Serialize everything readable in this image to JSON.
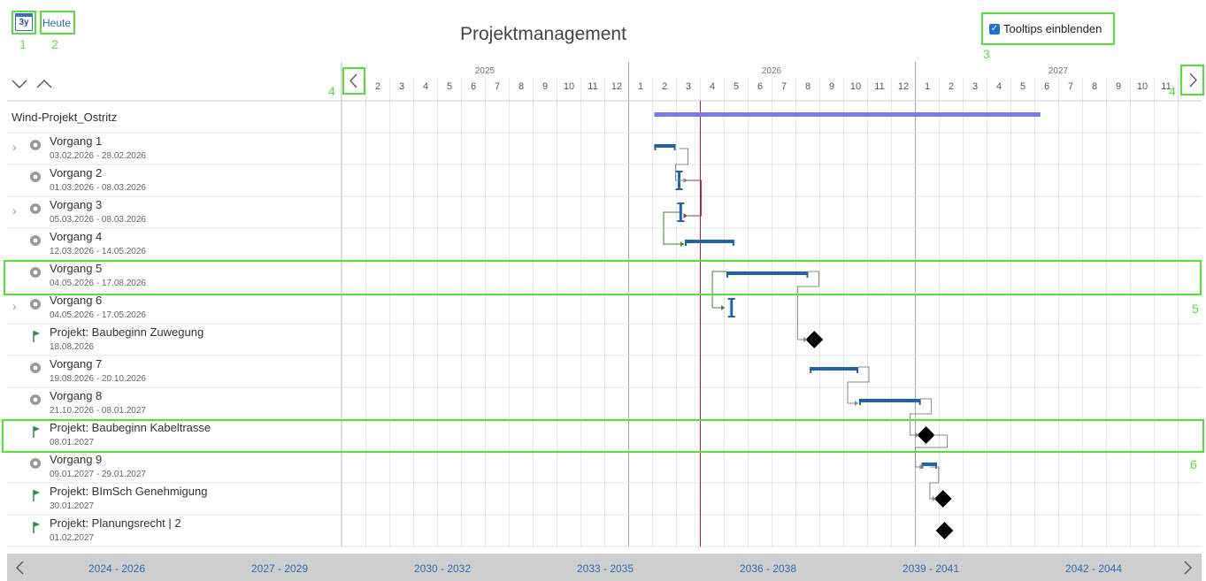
{
  "toolbar": {
    "zoom_label": "3y",
    "today_label": "Heute"
  },
  "title": "Projektmanagement",
  "tooltips": {
    "label": "Tooltips einblenden",
    "checked": true
  },
  "annotations": [
    "1",
    "2",
    "3",
    "4",
    "4",
    "5",
    "6"
  ],
  "timeline": {
    "years": [
      "2025",
      "2026",
      "2027"
    ],
    "months_2025": [
      "2",
      "3",
      "4",
      "5",
      "6",
      "7",
      "8",
      "9",
      "10",
      "11",
      "12"
    ],
    "months_2026": [
      "1",
      "2",
      "3",
      "4",
      "5",
      "6",
      "7",
      "8",
      "9",
      "10",
      "11",
      "12"
    ],
    "months_2027": [
      "1",
      "2",
      "3",
      "4",
      "5",
      "6",
      "7",
      "8",
      "9",
      "10",
      "11"
    ]
  },
  "project": {
    "name": "Wind-Projekt_Ostritz"
  },
  "tasks": [
    {
      "name": "Vorgang 1",
      "dates": "03.02.2026 - 28.02.2026",
      "icon": "gear-icon",
      "expandable": true
    },
    {
      "name": "Vorgang 2",
      "dates": "01.03.2026 - 08.03.2026",
      "icon": "gear-icon",
      "expandable": false
    },
    {
      "name": "Vorgang 3",
      "dates": "05.03.2026 - 08.03.2026",
      "icon": "gear-icon",
      "expandable": true
    },
    {
      "name": "Vorgang 4",
      "dates": "12.03.2026 - 14.05.2026",
      "icon": "gear-icon",
      "expandable": false
    },
    {
      "name": "Vorgang 5",
      "dates": "04.05.2026 - 17.08.2026",
      "icon": "gear-icon",
      "expandable": false
    },
    {
      "name": "Vorgang 6",
      "dates": "04.05.2026 - 17.05.2026",
      "icon": "gear-icon",
      "expandable": true
    },
    {
      "name": "Projekt: Baubeginn Zuwegung",
      "dates": "18.08.2026",
      "icon": "flag-icon",
      "expandable": false
    },
    {
      "name": "Vorgang 7",
      "dates": "19.08.2026 - 20.10.2026",
      "icon": "gear-icon",
      "expandable": false
    },
    {
      "name": "Vorgang 8",
      "dates": "21.10.2026 - 08.01.2027",
      "icon": "gear-icon",
      "expandable": false
    },
    {
      "name": "Projekt: Baubeginn Kabeltrasse",
      "dates": "08.01.2027",
      "icon": "flag-icon",
      "expandable": false
    },
    {
      "name": "Vorgang 9",
      "dates": "09.01.2027 - 29.01.2027",
      "icon": "gear-icon",
      "expandable": false
    },
    {
      "name": "Projekt: BImSch Genehmigung",
      "dates": "30.01.2027",
      "icon": "flag-icon",
      "expandable": false
    },
    {
      "name": "Projekt: Planungsrecht | 2",
      "dates": "01.02.2027",
      "icon": "flag-icon",
      "expandable": false
    }
  ],
  "periods": [
    "2024 - 2026",
    "2027 - 2029",
    "2030 - 2032",
    "2033 - 2035",
    "2036 - 2038",
    "2039 - 2041",
    "2042 - 2044"
  ],
  "colors": {
    "accent": "#2b6cb0",
    "bar": "#1f63a8",
    "summary": "#7b7be8",
    "today": "#b22222",
    "highlight": "#55e03a"
  }
}
